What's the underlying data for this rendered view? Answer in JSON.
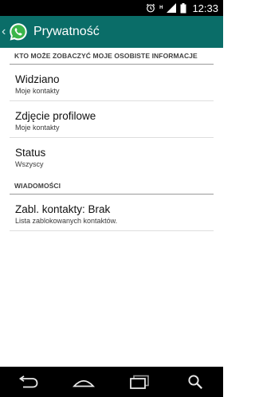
{
  "status_bar": {
    "clock": "12:33",
    "network": "H",
    "icons": [
      "alarm-icon",
      "network-h-icon",
      "signal-icon",
      "battery-icon"
    ]
  },
  "action_bar": {
    "title": "Prywatność",
    "logo_icon": "whatsapp-logo",
    "background_color": "#0a6d68"
  },
  "sections": [
    {
      "header": "KTO MOŻE ZOBACZYĆ MOJE OSOBISTE INFORMACJE",
      "items": [
        {
          "title": "Widziano",
          "subtitle": "Moje kontakty"
        },
        {
          "title": "Zdjęcie profilowe",
          "subtitle": "Moje kontakty"
        },
        {
          "title": "Status",
          "subtitle": "Wszyscy"
        }
      ]
    },
    {
      "header": "WIADOMOŚCI",
      "items": [
        {
          "title": "Zabl. kontakty: Brak",
          "subtitle": "Lista zablokowanych kontaktów."
        }
      ]
    }
  ],
  "nav_bar": {
    "icons": [
      "back-icon",
      "home-icon",
      "recent-apps-icon",
      "search-icon"
    ]
  }
}
